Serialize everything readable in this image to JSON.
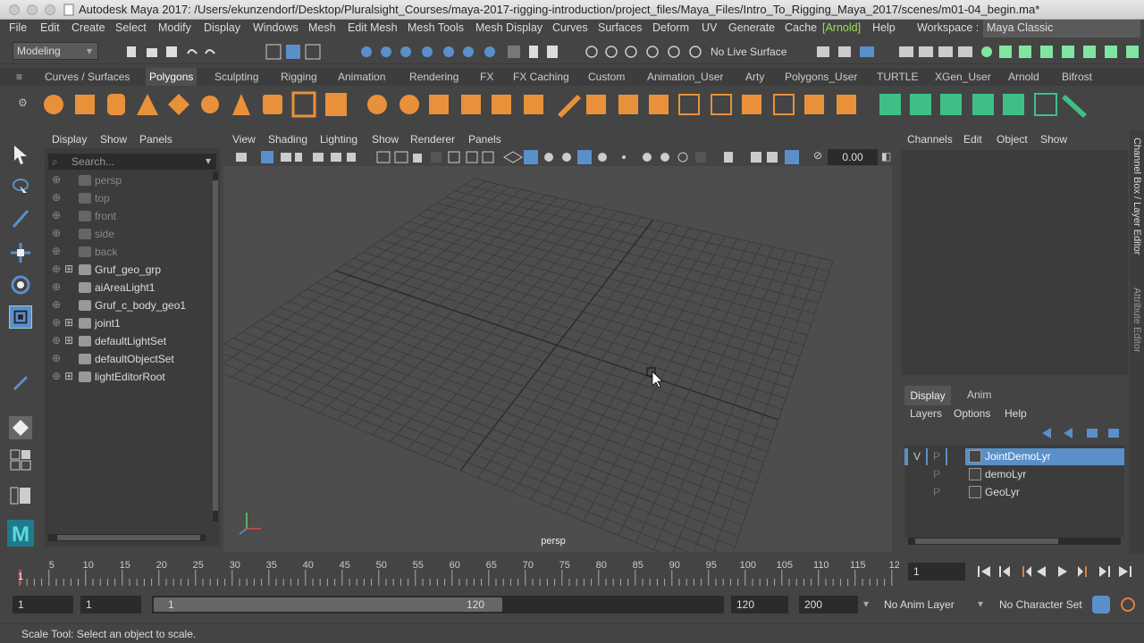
{
  "window": {
    "title": "Autodesk Maya 2017: /Users/ekunzendorf/Desktop/Pluralsight_Courses/maya-2017-rigging-introduction/project_files/Maya_Files/Intro_To_Rigging_Maya_2017/scenes/m01-04_begin.ma*"
  },
  "menubar": {
    "items": [
      "File",
      "Edit",
      "Create",
      "Select",
      "Modify",
      "Display",
      "Windows",
      "Mesh",
      "Edit Mesh",
      "Mesh Tools",
      "Mesh Display",
      "Curves",
      "Surfaces",
      "Deform",
      "UV",
      "Generate",
      "Cache",
      "[Arnold]",
      "Help"
    ],
    "workspace_label": "Workspace :",
    "workspace_value": "Maya Classic"
  },
  "statusline": {
    "mode": "Modeling",
    "live_surface": "No Live Surface"
  },
  "shelf": {
    "tabs": [
      "Curves / Surfaces",
      "Polygons",
      "Sculpting",
      "Rigging",
      "Animation",
      "Rendering",
      "FX",
      "FX Caching",
      "Custom",
      "Animation_User",
      "Arty",
      "Polygons_User",
      "TURTLE",
      "XGen_User",
      "Arnold",
      "Bifrost"
    ],
    "active_tab": "Polygons"
  },
  "outliner": {
    "menu": [
      "Display",
      "Show",
      "Panels"
    ],
    "search_placeholder": "Search...",
    "items": [
      {
        "label": "persp",
        "dim": true,
        "icon": "camera-icon",
        "expand": false
      },
      {
        "label": "top",
        "dim": true,
        "icon": "camera-icon",
        "expand": false
      },
      {
        "label": "front",
        "dim": true,
        "icon": "camera-icon",
        "expand": false
      },
      {
        "label": "side",
        "dim": true,
        "icon": "camera-icon",
        "expand": false
      },
      {
        "label": "back",
        "dim": true,
        "icon": "camera-icon",
        "expand": false
      },
      {
        "label": "Gruf_geo_grp",
        "dim": false,
        "icon": "group-icon",
        "expand": true
      },
      {
        "label": "aiAreaLight1",
        "dim": false,
        "icon": "area-light-icon",
        "expand": false
      },
      {
        "label": "Gruf_c_body_geo1",
        "dim": false,
        "icon": "mesh-icon",
        "expand": false
      },
      {
        "label": "joint1",
        "dim": false,
        "icon": "joint-icon",
        "expand": true
      },
      {
        "label": "defaultLightSet",
        "dim": false,
        "icon": "set-icon",
        "expand": true
      },
      {
        "label": "defaultObjectSet",
        "dim": false,
        "icon": "set-icon",
        "expand": false
      },
      {
        "label": "lightEditorRoot",
        "dim": false,
        "icon": "set-icon",
        "expand": true
      }
    ]
  },
  "viewport": {
    "menu": [
      "View",
      "Shading",
      "Lighting",
      "Show",
      "Renderer",
      "Panels"
    ],
    "camera_label": "persp",
    "exposure_value": "0.00"
  },
  "channelbox": {
    "menu": [
      "Channels",
      "Edit",
      "Object",
      "Show"
    ],
    "side_tab_1": "Channel Box / Layer Editor",
    "side_tab_2": "Attribute Editor"
  },
  "layereditor": {
    "tabs": [
      "Display",
      "Anim"
    ],
    "active_tab": "Display",
    "menu": [
      "Layers",
      "Options",
      "Help"
    ],
    "layers": [
      {
        "name": "JointDemoLyr",
        "v": "V",
        "p": "P",
        "selected": true
      },
      {
        "name": "demoLyr",
        "v": "",
        "p": "P",
        "selected": false
      },
      {
        "name": "GeoLyr",
        "v": "",
        "p": "P",
        "selected": false
      }
    ]
  },
  "timeslider": {
    "ticks": [
      "5",
      "10",
      "15",
      "20",
      "25",
      "30",
      "35",
      "40",
      "45",
      "50",
      "55",
      "60",
      "65",
      "70",
      "75",
      "80",
      "85",
      "90",
      "95",
      "100",
      "105",
      "110",
      "115",
      "12"
    ],
    "current_frame_marker": "1",
    "current_frame_field": "1"
  },
  "range": {
    "start": "1",
    "playback_start": "1",
    "slider_start": "1",
    "slider_end": "120",
    "playback_end": "120",
    "end": "200",
    "anim_layer": "No Anim Layer",
    "character_set": "No Character Set"
  },
  "helpline": {
    "text": "Scale Tool: Select an object to scale."
  },
  "colors": {
    "accent_green": "#7ee6a0",
    "arnold_green": "#9fdc5a",
    "selection_blue": "#5a8fc9",
    "shelf_orange": "#e8913a"
  }
}
